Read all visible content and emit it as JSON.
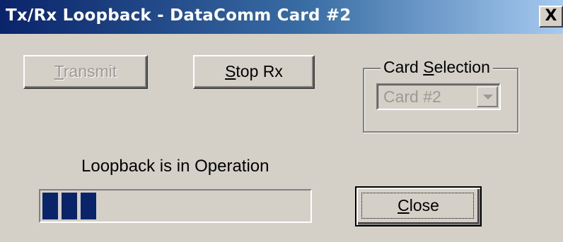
{
  "window": {
    "title": "Tx/Rx Loopback - DataComm Card #2",
    "close_glyph": "X"
  },
  "buttons": {
    "transmit": {
      "label_mnemonic": "T",
      "label_rest": "ransmit",
      "enabled": false
    },
    "stop_rx": {
      "label_mnemonic": "S",
      "label_rest": "top Rx",
      "enabled": true
    },
    "close": {
      "label_mnemonic": "C",
      "label_rest": "lose",
      "enabled": true,
      "focused": true
    }
  },
  "card_selection": {
    "label_before": "Card ",
    "label_mnemonic": "S",
    "label_after": "election",
    "selected_value": "Card #2",
    "enabled": false,
    "arrow_icon": "chevron-down-icon"
  },
  "status": {
    "text": "Loopback is in Operation"
  },
  "progress": {
    "blocks_filled": 3,
    "fill_fraction": 0.22,
    "block_color": "#0a246a"
  },
  "colors": {
    "face": "#d4d0c8",
    "title_start": "#0a246a",
    "title_end": "#a6caf0",
    "disabled_text": "#9c9a94"
  }
}
